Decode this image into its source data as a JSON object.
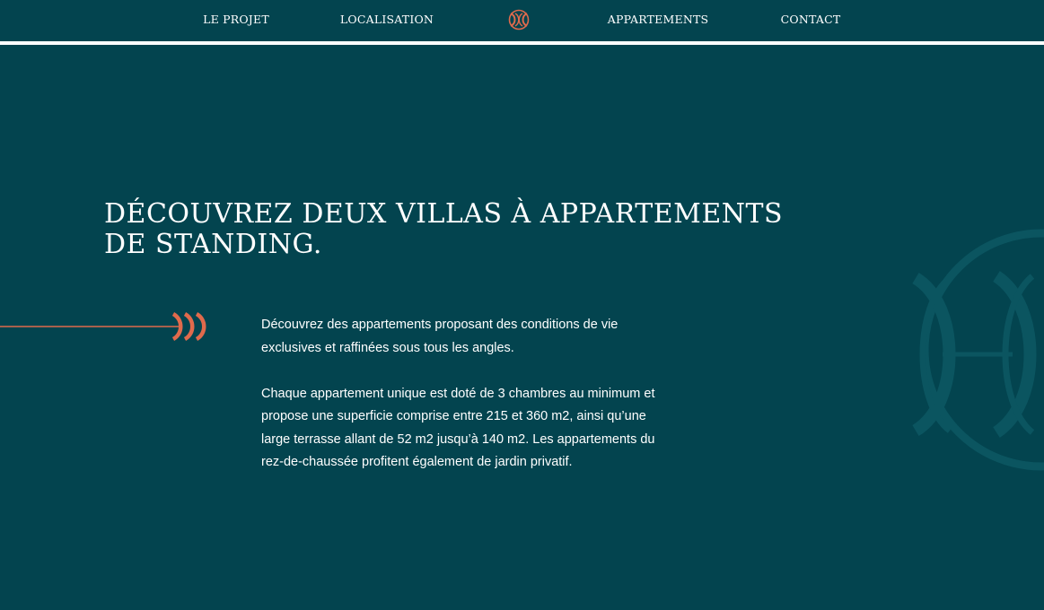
{
  "nav": {
    "items": [
      {
        "label": "LE PROJET"
      },
      {
        "label": "LOCALISATION"
      },
      {
        "label": "APPARTEMENTS"
      },
      {
        "label": "CONTACT"
      }
    ],
    "logo_icon": "brand-monogram-icon"
  },
  "hero": {
    "headline": "DÉCOUVREZ DEUX VILLAS À APPARTEMENTS DE STANDING.",
    "paragraphs": [
      "Découvrez des appartements proposant des conditions de vie exclusives et raffinées sous tous les angles.",
      "Chaque appartement unique est doté de 3 chambres au minimum et propose une superficie comprise entre 215 et 360 m2, ainsi qu’une large terrasse allant de 52 m2 jusqu’à 140 m2. Les appartements du rez-de-chaussée profitent également de jardin privatif."
    ],
    "arrow_icon": "arrow-decoration-icon",
    "watermark_icon": "monogram-watermark-icon"
  },
  "colors": {
    "background": "#03444f",
    "accent": "#e06a4c",
    "text": "#ffffff",
    "watermark": "#0b5560"
  }
}
